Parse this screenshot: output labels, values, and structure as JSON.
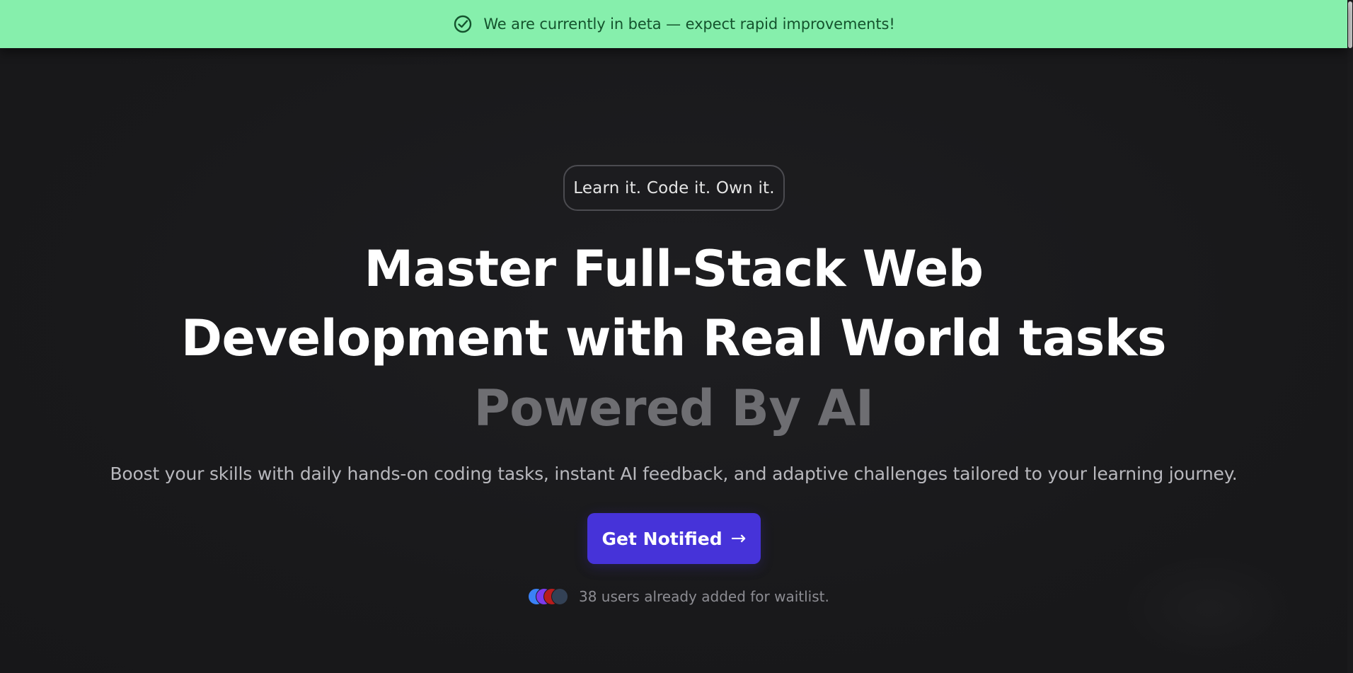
{
  "banner": {
    "icon": "check-circle-icon",
    "text": "We are currently in beta — expect rapid improvements!",
    "bg_color": "#86efac",
    "text_color": "#14532d"
  },
  "hero": {
    "tagline": "Learn it. Code it. Own it.",
    "headline_line1": "Master Full-Stack Web",
    "headline_line2": "Development with Real World tasks",
    "headline_line3": "Powered By AI",
    "subtitle": "Boost your skills with daily hands-on coding tasks, instant AI feedback, and adaptive challenges tailored to your learning journey."
  },
  "cta": {
    "label": "Get Notified",
    "arrow": "→",
    "color": "#4633d9"
  },
  "waitlist": {
    "text": "38 users already added for waitlist.",
    "avatar_colors": [
      "#3b82f6",
      "#7c3aed",
      "#b91c1c",
      "#334155"
    ]
  }
}
